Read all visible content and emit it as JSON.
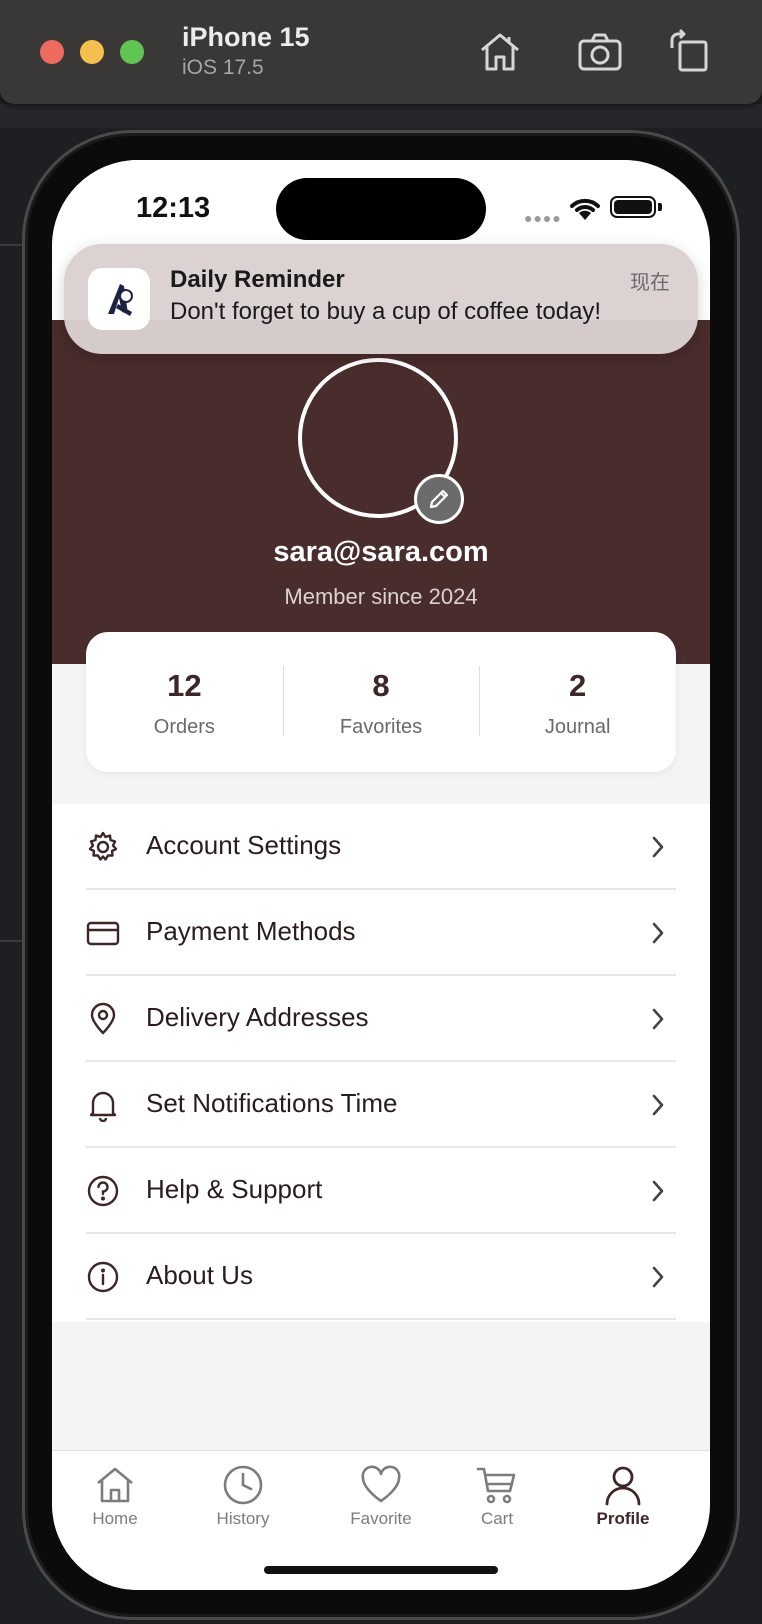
{
  "simulator": {
    "device_name": "iPhone 15",
    "os_version": "iOS 17.5",
    "toolbar_icons": [
      "home-icon",
      "screenshot-icon",
      "rotate-icon"
    ]
  },
  "status_bar": {
    "time": "12:13"
  },
  "notification": {
    "title": "Daily Reminder",
    "body": "Don't forget to buy a cup of coffee today!",
    "time": "现在"
  },
  "profile": {
    "email": "sara@sara.com",
    "member_since": "Member since 2024"
  },
  "stats": [
    {
      "value": "12",
      "label": "Orders"
    },
    {
      "value": "8",
      "label": "Favorites"
    },
    {
      "value": "2",
      "label": "Journal"
    }
  ],
  "menu": [
    {
      "label": "Account Settings",
      "icon": "gear-icon"
    },
    {
      "label": "Payment Methods",
      "icon": "credit-card-icon"
    },
    {
      "label": "Delivery Addresses",
      "icon": "location-pin-icon"
    },
    {
      "label": "Set Notifications Time",
      "icon": "bell-icon"
    },
    {
      "label": "Help & Support",
      "icon": "help-circle-icon"
    },
    {
      "label": "About Us",
      "icon": "info-circle-icon"
    }
  ],
  "tabs": [
    {
      "label": "Home",
      "icon": "home-icon"
    },
    {
      "label": "History",
      "icon": "clock-icon"
    },
    {
      "label": "Favorite",
      "icon": "heart-icon"
    },
    {
      "label": "Cart",
      "icon": "cart-icon"
    },
    {
      "label": "Profile",
      "icon": "person-icon",
      "active": true
    }
  ],
  "colors": {
    "brand_brown": "#492c2c",
    "text_dark": "#2a1c1c",
    "tab_inactive": "#7c7c7c"
  }
}
